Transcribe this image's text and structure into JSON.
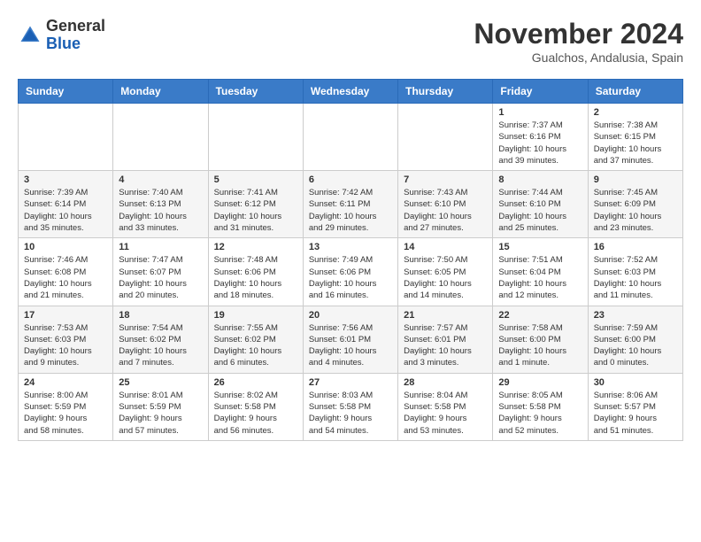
{
  "header": {
    "logo": {
      "text_general": "General",
      "text_blue": "Blue"
    },
    "month": "November 2024",
    "location": "Gualchos, Andalusia, Spain"
  },
  "weekdays": [
    "Sunday",
    "Monday",
    "Tuesday",
    "Wednesday",
    "Thursday",
    "Friday",
    "Saturday"
  ],
  "weeks": [
    [
      {
        "day": "",
        "info": ""
      },
      {
        "day": "",
        "info": ""
      },
      {
        "day": "",
        "info": ""
      },
      {
        "day": "",
        "info": ""
      },
      {
        "day": "",
        "info": ""
      },
      {
        "day": "1",
        "info": "Sunrise: 7:37 AM\nSunset: 6:16 PM\nDaylight: 10 hours\nand 39 minutes."
      },
      {
        "day": "2",
        "info": "Sunrise: 7:38 AM\nSunset: 6:15 PM\nDaylight: 10 hours\nand 37 minutes."
      }
    ],
    [
      {
        "day": "3",
        "info": "Sunrise: 7:39 AM\nSunset: 6:14 PM\nDaylight: 10 hours\nand 35 minutes."
      },
      {
        "day": "4",
        "info": "Sunrise: 7:40 AM\nSunset: 6:13 PM\nDaylight: 10 hours\nand 33 minutes."
      },
      {
        "day": "5",
        "info": "Sunrise: 7:41 AM\nSunset: 6:12 PM\nDaylight: 10 hours\nand 31 minutes."
      },
      {
        "day": "6",
        "info": "Sunrise: 7:42 AM\nSunset: 6:11 PM\nDaylight: 10 hours\nand 29 minutes."
      },
      {
        "day": "7",
        "info": "Sunrise: 7:43 AM\nSunset: 6:10 PM\nDaylight: 10 hours\nand 27 minutes."
      },
      {
        "day": "8",
        "info": "Sunrise: 7:44 AM\nSunset: 6:10 PM\nDaylight: 10 hours\nand 25 minutes."
      },
      {
        "day": "9",
        "info": "Sunrise: 7:45 AM\nSunset: 6:09 PM\nDaylight: 10 hours\nand 23 minutes."
      }
    ],
    [
      {
        "day": "10",
        "info": "Sunrise: 7:46 AM\nSunset: 6:08 PM\nDaylight: 10 hours\nand 21 minutes."
      },
      {
        "day": "11",
        "info": "Sunrise: 7:47 AM\nSunset: 6:07 PM\nDaylight: 10 hours\nand 20 minutes."
      },
      {
        "day": "12",
        "info": "Sunrise: 7:48 AM\nSunset: 6:06 PM\nDaylight: 10 hours\nand 18 minutes."
      },
      {
        "day": "13",
        "info": "Sunrise: 7:49 AM\nSunset: 6:06 PM\nDaylight: 10 hours\nand 16 minutes."
      },
      {
        "day": "14",
        "info": "Sunrise: 7:50 AM\nSunset: 6:05 PM\nDaylight: 10 hours\nand 14 minutes."
      },
      {
        "day": "15",
        "info": "Sunrise: 7:51 AM\nSunset: 6:04 PM\nDaylight: 10 hours\nand 12 minutes."
      },
      {
        "day": "16",
        "info": "Sunrise: 7:52 AM\nSunset: 6:03 PM\nDaylight: 10 hours\nand 11 minutes."
      }
    ],
    [
      {
        "day": "17",
        "info": "Sunrise: 7:53 AM\nSunset: 6:03 PM\nDaylight: 10 hours\nand 9 minutes."
      },
      {
        "day": "18",
        "info": "Sunrise: 7:54 AM\nSunset: 6:02 PM\nDaylight: 10 hours\nand 7 minutes."
      },
      {
        "day": "19",
        "info": "Sunrise: 7:55 AM\nSunset: 6:02 PM\nDaylight: 10 hours\nand 6 minutes."
      },
      {
        "day": "20",
        "info": "Sunrise: 7:56 AM\nSunset: 6:01 PM\nDaylight: 10 hours\nand 4 minutes."
      },
      {
        "day": "21",
        "info": "Sunrise: 7:57 AM\nSunset: 6:01 PM\nDaylight: 10 hours\nand 3 minutes."
      },
      {
        "day": "22",
        "info": "Sunrise: 7:58 AM\nSunset: 6:00 PM\nDaylight: 10 hours\nand 1 minute."
      },
      {
        "day": "23",
        "info": "Sunrise: 7:59 AM\nSunset: 6:00 PM\nDaylight: 10 hours\nand 0 minutes."
      }
    ],
    [
      {
        "day": "24",
        "info": "Sunrise: 8:00 AM\nSunset: 5:59 PM\nDaylight: 9 hours\nand 58 minutes."
      },
      {
        "day": "25",
        "info": "Sunrise: 8:01 AM\nSunset: 5:59 PM\nDaylight: 9 hours\nand 57 minutes."
      },
      {
        "day": "26",
        "info": "Sunrise: 8:02 AM\nSunset: 5:58 PM\nDaylight: 9 hours\nand 56 minutes."
      },
      {
        "day": "27",
        "info": "Sunrise: 8:03 AM\nSunset: 5:58 PM\nDaylight: 9 hours\nand 54 minutes."
      },
      {
        "day": "28",
        "info": "Sunrise: 8:04 AM\nSunset: 5:58 PM\nDaylight: 9 hours\nand 53 minutes."
      },
      {
        "day": "29",
        "info": "Sunrise: 8:05 AM\nSunset: 5:58 PM\nDaylight: 9 hours\nand 52 minutes."
      },
      {
        "day": "30",
        "info": "Sunrise: 8:06 AM\nSunset: 5:57 PM\nDaylight: 9 hours\nand 51 minutes."
      }
    ]
  ]
}
